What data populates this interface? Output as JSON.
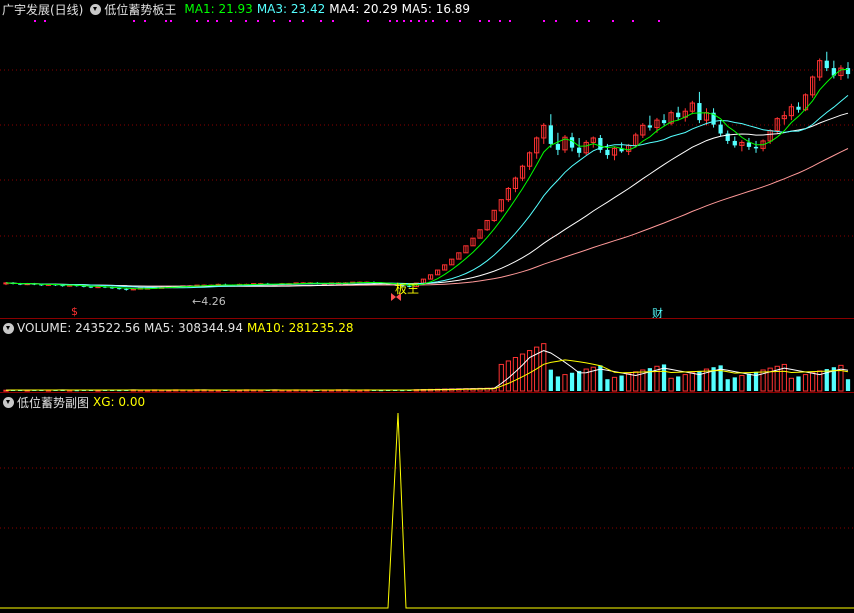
{
  "price_header": {
    "stock_title": "广宇发展(日线)",
    "formula_name": "低位蓄势板王",
    "ma1": "MA1: 21.93",
    "ma3": "MA3: 23.42",
    "ma4": "MA4: 20.29",
    "ma5": "MA5: 16.89"
  },
  "price_annotations": {
    "low_price_label": "←4.26",
    "signal_label": "板王",
    "dollar_marker": "$",
    "finance_marker": "财"
  },
  "volume_header": {
    "volume": "VOLUME: 243522.56",
    "ma5": "MA5: 308344.94",
    "ma10": "MA10: 281235.28"
  },
  "indicator_header": {
    "name": "低位蓄势副图",
    "xg": "XG: 0.00"
  },
  "colors": {
    "background": "#000000",
    "up_candle": "#ff3232",
    "down_candle": "#54ffff",
    "ma1_line": "#00ff00",
    "ma3_line": "#54ffff",
    "ma4_line": "#ffffff",
    "ma5_line": "#ff9999",
    "grid": "#8a0000",
    "signal_yellow": "#ffff00",
    "dots": "#ff00ff"
  },
  "chart_data": {
    "type": "candlestick",
    "ma_lines": [
      "MA1",
      "MA3",
      "MA4",
      "MA5"
    ],
    "xg_signal_values": [
      0,
      1,
      0
    ],
    "candles": [
      {
        "o": 5.2,
        "h": 5.4,
        "l": 5.0,
        "c": 5.3
      },
      {
        "o": 5.3,
        "h": 5.4,
        "l": 5.1,
        "c": 5.2
      },
      {
        "o": 5.2,
        "h": 5.3,
        "l": 5.0,
        "c": 5.1
      },
      {
        "o": 5.1,
        "h": 5.3,
        "l": 5.0,
        "c": 5.2
      },
      {
        "o": 5.2,
        "h": 5.3,
        "l": 5.0,
        "c": 5.1
      },
      {
        "o": 5.1,
        "h": 5.2,
        "l": 4.9,
        "c": 5.0
      },
      {
        "o": 5.0,
        "h": 5.2,
        "l": 4.9,
        "c": 5.1
      },
      {
        "o": 5.1,
        "h": 5.2,
        "l": 4.9,
        "c": 5.0
      },
      {
        "o": 5.0,
        "h": 5.1,
        "l": 4.8,
        "c": 4.9
      },
      {
        "o": 4.9,
        "h": 5.1,
        "l": 4.8,
        "c": 5.0
      },
      {
        "o": 5.0,
        "h": 5.1,
        "l": 4.8,
        "c": 4.9
      },
      {
        "o": 4.9,
        "h": 5.0,
        "l": 4.7,
        "c": 4.8
      },
      {
        "o": 4.8,
        "h": 4.9,
        "l": 4.6,
        "c": 4.7
      },
      {
        "o": 4.7,
        "h": 4.9,
        "l": 4.6,
        "c": 4.8
      },
      {
        "o": 4.8,
        "h": 4.9,
        "l": 4.6,
        "c": 4.7
      },
      {
        "o": 4.7,
        "h": 4.8,
        "l": 4.5,
        "c": 4.6
      },
      {
        "o": 4.6,
        "h": 4.7,
        "l": 4.4,
        "c": 4.5
      },
      {
        "o": 4.5,
        "h": 4.6,
        "l": 4.26,
        "c": 4.4
      },
      {
        "o": 4.4,
        "h": 4.6,
        "l": 4.3,
        "c": 4.5
      },
      {
        "o": 4.5,
        "h": 4.6,
        "l": 4.4,
        "c": 4.6
      },
      {
        "o": 4.6,
        "h": 4.7,
        "l": 4.5,
        "c": 4.6
      },
      {
        "o": 4.6,
        "h": 4.7,
        "l": 4.5,
        "c": 4.7
      },
      {
        "o": 4.7,
        "h": 4.8,
        "l": 4.6,
        "c": 4.7
      },
      {
        "o": 4.7,
        "h": 4.8,
        "l": 4.6,
        "c": 4.8
      },
      {
        "o": 4.8,
        "h": 4.9,
        "l": 4.7,
        "c": 4.8
      },
      {
        "o": 4.8,
        "h": 4.9,
        "l": 4.7,
        "c": 4.9
      },
      {
        "o": 4.9,
        "h": 5.0,
        "l": 4.8,
        "c": 4.9
      },
      {
        "o": 4.9,
        "h": 5.0,
        "l": 4.8,
        "c": 5.0
      },
      {
        "o": 5.0,
        "h": 5.1,
        "l": 4.9,
        "c": 5.0
      },
      {
        "o": 5.0,
        "h": 5.1,
        "l": 4.9,
        "c": 5.0
      },
      {
        "o": 5.0,
        "h": 5.2,
        "l": 4.9,
        "c": 5.1
      },
      {
        "o": 5.1,
        "h": 5.2,
        "l": 4.9,
        "c": 5.0
      },
      {
        "o": 5.0,
        "h": 5.1,
        "l": 4.9,
        "c": 5.0
      },
      {
        "o": 5.0,
        "h": 5.2,
        "l": 4.9,
        "c": 5.1
      },
      {
        "o": 5.1,
        "h": 5.2,
        "l": 5.0,
        "c": 5.1
      },
      {
        "o": 5.1,
        "h": 5.2,
        "l": 5.0,
        "c": 5.2
      },
      {
        "o": 5.2,
        "h": 5.3,
        "l": 5.1,
        "c": 5.2
      },
      {
        "o": 5.2,
        "h": 5.3,
        "l": 5.0,
        "c": 5.1
      },
      {
        "o": 5.1,
        "h": 5.2,
        "l": 5.0,
        "c": 5.1
      },
      {
        "o": 5.1,
        "h": 5.3,
        "l": 5.0,
        "c": 5.2
      },
      {
        "o": 5.2,
        "h": 5.3,
        "l": 5.1,
        "c": 5.2
      },
      {
        "o": 5.2,
        "h": 5.3,
        "l": 5.1,
        "c": 5.3
      },
      {
        "o": 5.3,
        "h": 5.4,
        "l": 5.2,
        "c": 5.3
      },
      {
        "o": 5.3,
        "h": 5.4,
        "l": 5.2,
        "c": 5.3
      },
      {
        "o": 5.3,
        "h": 5.4,
        "l": 5.1,
        "c": 5.2
      },
      {
        "o": 5.2,
        "h": 5.3,
        "l": 5.1,
        "c": 5.2
      },
      {
        "o": 5.2,
        "h": 5.3,
        "l": 5.1,
        "c": 5.3
      },
      {
        "o": 5.3,
        "h": 5.4,
        "l": 5.2,
        "c": 5.3
      },
      {
        "o": 5.3,
        "h": 5.4,
        "l": 5.2,
        "c": 5.3
      },
      {
        "o": 5.3,
        "h": 5.4,
        "l": 5.2,
        "c": 5.4
      },
      {
        "o": 5.4,
        "h": 5.5,
        "l": 5.3,
        "c": 5.4
      },
      {
        "o": 5.4,
        "h": 5.5,
        "l": 5.3,
        "c": 5.4
      },
      {
        "o": 5.4,
        "h": 5.5,
        "l": 5.2,
        "c": 5.3
      },
      {
        "o": 5.3,
        "h": 5.4,
        "l": 5.1,
        "c": 5.2
      },
      {
        "o": 5.2,
        "h": 5.3,
        "l": 5.0,
        "c": 5.1
      },
      {
        "o": 5.1,
        "h": 5.2,
        "l": 4.9,
        "c": 5.0
      },
      {
        "o": 5.0,
        "h": 5.1,
        "l": 4.8,
        "c": 4.9
      },
      {
        "o": 4.9,
        "h": 5.0,
        "l": 4.7,
        "c": 4.8
      },
      {
        "o": 4.8,
        "h": 5.3,
        "l": 4.8,
        "c": 5.28
      },
      {
        "o": 5.28,
        "h": 5.81,
        "l": 5.28,
        "c": 5.81
      },
      {
        "o": 5.81,
        "h": 6.39,
        "l": 5.81,
        "c": 6.39
      },
      {
        "o": 6.39,
        "h": 7.03,
        "l": 6.39,
        "c": 7.03
      },
      {
        "o": 7.03,
        "h": 7.73,
        "l": 7.03,
        "c": 7.73
      },
      {
        "o": 7.73,
        "h": 8.5,
        "l": 7.73,
        "c": 8.5
      },
      {
        "o": 8.5,
        "h": 9.35,
        "l": 8.5,
        "c": 9.35
      },
      {
        "o": 9.35,
        "h": 10.29,
        "l": 9.35,
        "c": 10.29
      },
      {
        "o": 10.29,
        "h": 11.32,
        "l": 10.29,
        "c": 11.32
      },
      {
        "o": 11.32,
        "h": 12.45,
        "l": 11.3,
        "c": 12.45
      },
      {
        "o": 12.45,
        "h": 13.7,
        "l": 12.3,
        "c": 13.7
      },
      {
        "o": 13.7,
        "h": 15.07,
        "l": 13.5,
        "c": 15.07
      },
      {
        "o": 15.0,
        "h": 16.5,
        "l": 14.8,
        "c": 16.5
      },
      {
        "o": 16.5,
        "h": 18.2,
        "l": 16.2,
        "c": 18.0
      },
      {
        "o": 18.0,
        "h": 19.6,
        "l": 17.5,
        "c": 19.4
      },
      {
        "o": 19.4,
        "h": 21.2,
        "l": 19.0,
        "c": 21.0
      },
      {
        "o": 21.0,
        "h": 23.0,
        "l": 20.5,
        "c": 22.8
      },
      {
        "o": 22.8,
        "h": 25.0,
        "l": 22.0,
        "c": 24.8
      },
      {
        "o": 24.8,
        "h": 26.8,
        "l": 24.0,
        "c": 26.5
      },
      {
        "o": 26.5,
        "h": 28.0,
        "l": 23.5,
        "c": 24.0
      },
      {
        "o": 24.0,
        "h": 25.5,
        "l": 22.5,
        "c": 23.2
      },
      {
        "o": 23.2,
        "h": 25.2,
        "l": 22.8,
        "c": 24.9
      },
      {
        "o": 24.9,
        "h": 25.5,
        "l": 23.0,
        "c": 23.5
      },
      {
        "o": 23.5,
        "h": 24.8,
        "l": 22.2,
        "c": 22.8
      },
      {
        "o": 22.8,
        "h": 24.5,
        "l": 22.5,
        "c": 24.2
      },
      {
        "o": 24.2,
        "h": 25.0,
        "l": 23.5,
        "c": 24.8
      },
      {
        "o": 24.8,
        "h": 25.2,
        "l": 22.8,
        "c": 23.2
      },
      {
        "o": 23.2,
        "h": 24.0,
        "l": 22.0,
        "c": 22.5
      },
      {
        "o": 22.5,
        "h": 23.6,
        "l": 21.8,
        "c": 23.4
      },
      {
        "o": 23.4,
        "h": 24.2,
        "l": 22.8,
        "c": 23.0
      },
      {
        "o": 23.0,
        "h": 24.0,
        "l": 22.5,
        "c": 23.8
      },
      {
        "o": 23.8,
        "h": 25.5,
        "l": 23.5,
        "c": 25.2
      },
      {
        "o": 25.2,
        "h": 26.8,
        "l": 24.8,
        "c": 26.5
      },
      {
        "o": 26.5,
        "h": 27.8,
        "l": 25.8,
        "c": 26.2
      },
      {
        "o": 26.2,
        "h": 27.5,
        "l": 25.5,
        "c": 27.2
      },
      {
        "o": 27.2,
        "h": 28.0,
        "l": 26.5,
        "c": 26.8
      },
      {
        "o": 26.8,
        "h": 28.5,
        "l": 26.5,
        "c": 28.2
      },
      {
        "o": 28.2,
        "h": 29.0,
        "l": 27.2,
        "c": 27.6
      },
      {
        "o": 27.6,
        "h": 28.8,
        "l": 27.0,
        "c": 28.4
      },
      {
        "o": 28.4,
        "h": 29.8,
        "l": 28.0,
        "c": 29.5
      },
      {
        "o": 29.5,
        "h": 31.0,
        "l": 26.8,
        "c": 27.2
      },
      {
        "o": 27.2,
        "h": 28.8,
        "l": 26.5,
        "c": 28.2
      },
      {
        "o": 28.2,
        "h": 28.8,
        "l": 26.2,
        "c": 26.6
      },
      {
        "o": 26.6,
        "h": 27.2,
        "l": 25.0,
        "c": 25.4
      },
      {
        "o": 25.4,
        "h": 25.8,
        "l": 24.0,
        "c": 24.4
      },
      {
        "o": 24.4,
        "h": 25.0,
        "l": 23.5,
        "c": 23.8
      },
      {
        "o": 23.8,
        "h": 24.5,
        "l": 23.0,
        "c": 24.2
      },
      {
        "o": 24.2,
        "h": 24.8,
        "l": 23.2,
        "c": 23.6
      },
      {
        "o": 23.6,
        "h": 24.4,
        "l": 22.8,
        "c": 23.4
      },
      {
        "o": 23.4,
        "h": 24.6,
        "l": 23.0,
        "c": 24.4
      },
      {
        "o": 24.4,
        "h": 26.0,
        "l": 24.0,
        "c": 25.8
      },
      {
        "o": 25.8,
        "h": 27.6,
        "l": 25.4,
        "c": 27.4
      },
      {
        "o": 27.4,
        "h": 28.4,
        "l": 26.6,
        "c": 27.8
      },
      {
        "o": 27.8,
        "h": 29.4,
        "l": 27.2,
        "c": 29.0
      },
      {
        "o": 29.0,
        "h": 29.6,
        "l": 28.2,
        "c": 28.6
      },
      {
        "o": 28.6,
        "h": 30.8,
        "l": 28.4,
        "c": 30.6
      },
      {
        "o": 30.6,
        "h": 33.2,
        "l": 30.2,
        "c": 33.0
      },
      {
        "o": 33.0,
        "h": 35.5,
        "l": 32.5,
        "c": 35.2
      },
      {
        "o": 35.2,
        "h": 36.4,
        "l": 33.8,
        "c": 34.2
      },
      {
        "o": 34.2,
        "h": 35.2,
        "l": 32.8,
        "c": 33.2
      },
      {
        "o": 33.2,
        "h": 34.6,
        "l": 32.6,
        "c": 34.2
      },
      {
        "o": 34.2,
        "h": 35.0,
        "l": 32.8,
        "c": 33.4
      }
    ]
  }
}
